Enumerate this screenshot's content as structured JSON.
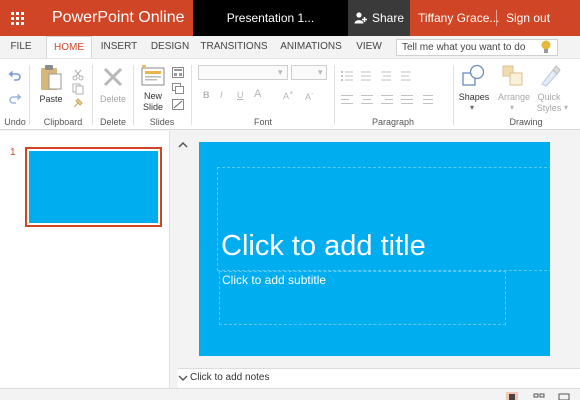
{
  "app": {
    "name": "PowerPoint Online",
    "brand_color": "#d04525"
  },
  "header": {
    "document_title": "Presentation 1...",
    "share_label": "Share",
    "user_name": "Tiffany Grace...",
    "sign_out_label": "Sign out"
  },
  "tabs": [
    "FILE",
    "HOME",
    "INSERT",
    "DESIGN",
    "TRANSITIONS",
    "ANIMATIONS",
    "VIEW"
  ],
  "active_tab": "HOME",
  "search": {
    "placeholder": "Tell me what you want to do"
  },
  "ribbon": {
    "groups": {
      "undo": "Undo",
      "clipboard": "Clipboard",
      "delete": "Delete",
      "slides": "Slides",
      "font": "Font",
      "paragraph": "Paragraph",
      "drawing": "Drawing"
    },
    "buttons": {
      "paste": "Paste",
      "delete": "Delete",
      "new_slide_line1": "New",
      "new_slide_line2": "Slide",
      "shapes": "Shapes",
      "arrange": "Arrange",
      "quick_styles_line1": "Quick",
      "quick_styles_line2": "Styles"
    }
  },
  "slide_panel": {
    "slide_number": "1"
  },
  "slide": {
    "background_color": "#00adef",
    "title_placeholder": "Click to add title",
    "subtitle_placeholder": "Click to add subtitle"
  },
  "notes": {
    "placeholder": "Click to add notes"
  }
}
